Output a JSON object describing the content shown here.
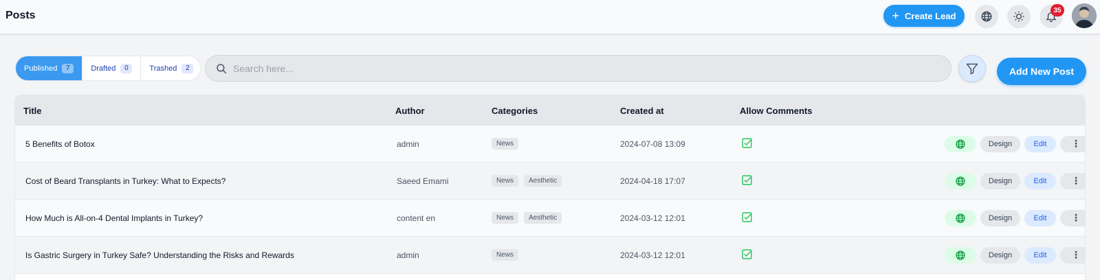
{
  "header": {
    "title": "Posts",
    "create_lead_label": "Create Lead",
    "notification_count": "35",
    "icons": [
      "globe-icon",
      "sun-icon",
      "bell-icon",
      "avatar"
    ]
  },
  "tabs": [
    {
      "label": "Published",
      "count": "7",
      "active": true
    },
    {
      "label": "Drafted",
      "count": "0",
      "active": false
    },
    {
      "label": "Trashed",
      "count": "2",
      "active": false
    }
  ],
  "search": {
    "placeholder": "Search here...",
    "value": ""
  },
  "add_post_label": "Add New Post",
  "table": {
    "columns": [
      "Title",
      "Author",
      "Categories",
      "Created at",
      "Allow Comments"
    ],
    "rows": [
      {
        "title": "5 Benefits of Botox",
        "author": "admin",
        "categories": [
          "News"
        ],
        "created_at": "2024-07-08 13:09",
        "allow_comments": true
      },
      {
        "title": "Cost of Beard Transplants in Turkey: What to Expects?",
        "author": "Saeed Emami",
        "categories": [
          "News",
          "Aesthetic"
        ],
        "created_at": "2024-04-18 17:07",
        "allow_comments": true
      },
      {
        "title": "How Much is All-on-4 Dental Implants in Turkey?",
        "author": "content en",
        "categories": [
          "News",
          "Aesthetic"
        ],
        "created_at": "2024-03-12 12:01",
        "allow_comments": true
      },
      {
        "title": "Is Gastric Surgery in Turkey Safe? Understanding the Risks and Rewards",
        "author": "admin",
        "categories": [
          "News"
        ],
        "created_at": "2024-03-12 12:01",
        "allow_comments": true
      }
    ],
    "action_labels": {
      "design": "Design",
      "edit": "Edit",
      "more": "⋮"
    }
  },
  "colors": {
    "primary": "#2196f3",
    "badge": "#e11d2e",
    "check": "#22c55e"
  }
}
